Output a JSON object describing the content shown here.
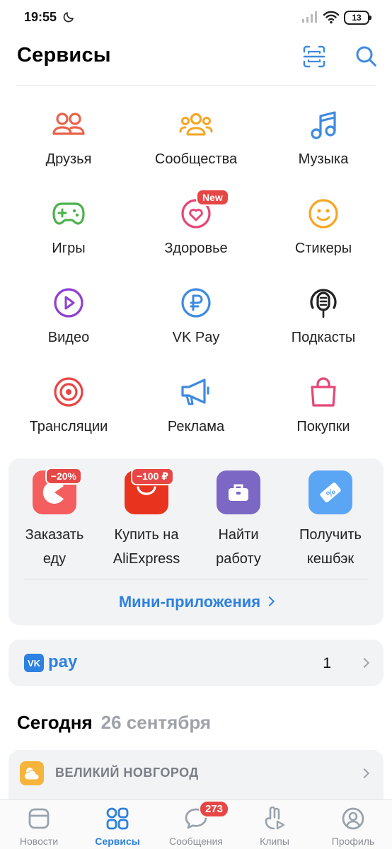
{
  "status_bar": {
    "time": "19:55",
    "battery": "13"
  },
  "header": {
    "title": "Сервисы"
  },
  "services": [
    {
      "label": "Друзья",
      "icon": "friends-icon",
      "color": "#e8634a"
    },
    {
      "label": "Сообщества",
      "icon": "communities-icon",
      "color": "#f5a623"
    },
    {
      "label": "Музыка",
      "icon": "music-icon",
      "color": "#3f8ae0"
    },
    {
      "label": "Игры",
      "icon": "gamepad-icon",
      "color": "#4bb34b"
    },
    {
      "label": "Здоровье",
      "icon": "health-icon",
      "color": "#e64677",
      "badge": "New"
    },
    {
      "label": "Стикеры",
      "icon": "smile-icon",
      "color": "#f5a623"
    },
    {
      "label": "Видео",
      "icon": "video-icon",
      "color": "#8f3fd1"
    },
    {
      "label": "VK Pay",
      "icon": "ruble-icon",
      "color": "#3f8ae0"
    },
    {
      "label": "Подкасты",
      "icon": "podcast-icon",
      "color": "#222222"
    },
    {
      "label": "Трансляции",
      "icon": "target-icon",
      "color": "#e64646"
    },
    {
      "label": "Реклама",
      "icon": "megaphone-icon",
      "color": "#3f8ae0"
    },
    {
      "label": "Покупки",
      "icon": "shopping-bag-icon",
      "color": "#e64677"
    }
  ],
  "mini_apps": {
    "items": [
      {
        "line1": "Заказать",
        "line2": "еду",
        "discount": "−20%",
        "icon": "food-icon",
        "color": "#f55e5e"
      },
      {
        "line1": "Купить на",
        "line2": "AliExpress",
        "discount": "−100 ₽",
        "icon": "aliexpress-icon",
        "color": "#e8341f"
      },
      {
        "line1": "Найти",
        "line2": "работу",
        "icon": "briefcase-icon",
        "color": "#7c67c4"
      },
      {
        "line1": "Получить",
        "line2": "кешбэк",
        "icon": "cashback-icon",
        "color": "#5aa6f5"
      }
    ],
    "link_label": "Мини-приложения"
  },
  "vk_pay": {
    "logo": "VK",
    "word": "pay",
    "value": "1"
  },
  "today": {
    "title": "Сегодня",
    "date": "26 сентября"
  },
  "weather": {
    "city": "ВЕЛИКИЙ НОВГОРОД"
  },
  "tabbar": {
    "tabs": [
      {
        "label": "Новости",
        "icon": "news-icon"
      },
      {
        "label": "Сервисы",
        "icon": "services-icon",
        "active": true
      },
      {
        "label": "Сообщения",
        "icon": "messages-icon",
        "badge": "273"
      },
      {
        "label": "Клипы",
        "icon": "clips-icon"
      },
      {
        "label": "Профиль",
        "icon": "profile-icon"
      }
    ]
  }
}
